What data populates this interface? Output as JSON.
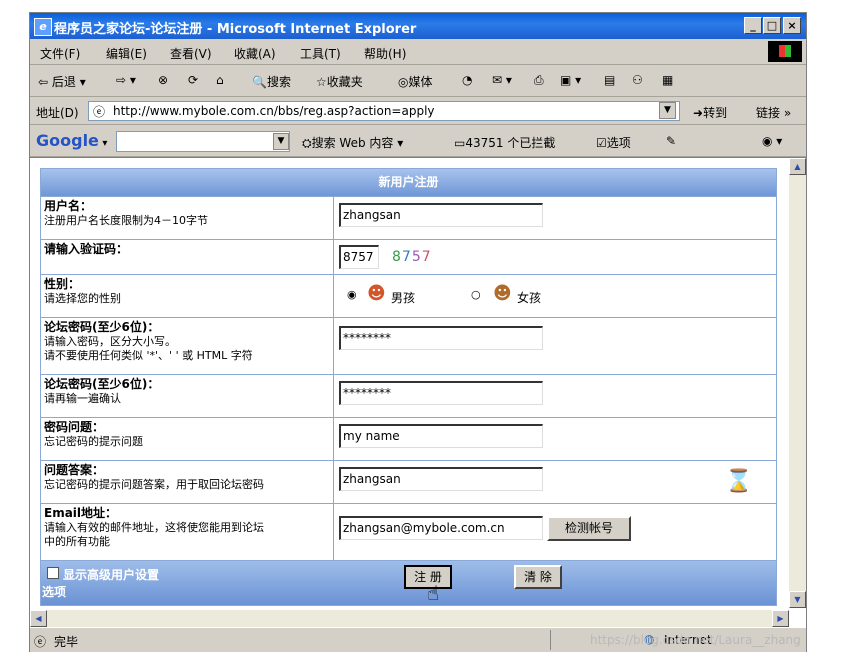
{
  "window": {
    "title": "程序员之家论坛-论坛注册 - Microsoft Internet Explorer",
    "minimize": "_",
    "maximize": "□",
    "close": "×"
  },
  "menu": [
    "文件(F)",
    "编辑(E)",
    "查看(V)",
    "收藏(A)",
    "工具(T)",
    "帮助(H)"
  ],
  "toolbar": {
    "back": "后退",
    "search": "搜索",
    "favorites": "收藏夹",
    "media": "媒体"
  },
  "address": {
    "label": "地址(D)",
    "url": "http://www.mybole.com.cn/bbs/reg.asp?action=apply",
    "go": "转到",
    "links": "链接"
  },
  "google": {
    "logo": "Google",
    "search_web": "搜索 Web 内容",
    "blocked": "43751 个已拦截",
    "options": "选项"
  },
  "form": {
    "heading": "新用户注册",
    "rows": [
      {
        "title": "用户名：",
        "desc": "注册用户名长度限制为4－10字节",
        "value": "zhangsan"
      },
      {
        "title": "请输入验证码：",
        "desc": "",
        "value": "8757",
        "captcha": "8757"
      },
      {
        "title": "性别：",
        "desc": "请选择您的性别",
        "male": "男孩",
        "female": "女孩"
      },
      {
        "title": "论坛密码(至少6位)：",
        "desc": "请输入密码，区分大小写。",
        "desc2": "请不要使用任何类似 '*'、' ' 或 HTML 字符",
        "value": "********"
      },
      {
        "title": "论坛密码(至少6位)：",
        "desc": "请再输一遍确认",
        "value": "********"
      },
      {
        "title": "密码问题：",
        "desc": "忘记密码的提示问题",
        "value": "my name"
      },
      {
        "title": "问题答案：",
        "desc": "忘记密码的提示问题答案，用于取回论坛密码",
        "value": "zhangsan"
      },
      {
        "title": "Email地址：",
        "desc": "请输入有效的邮件地址，这将使您能用到论坛",
        "desc2": "中的所有功能",
        "value": "zhangsan@mybole.com.cn",
        "button": "检测帐号"
      }
    ],
    "advanced": "显示高级用户设置",
    "advanced2": "选项",
    "submit": "注 册",
    "reset": "清 除"
  },
  "status": {
    "text": "完毕",
    "zone": "Internet"
  },
  "watermark": "https://blog.csdn.net/Laura__zhang"
}
